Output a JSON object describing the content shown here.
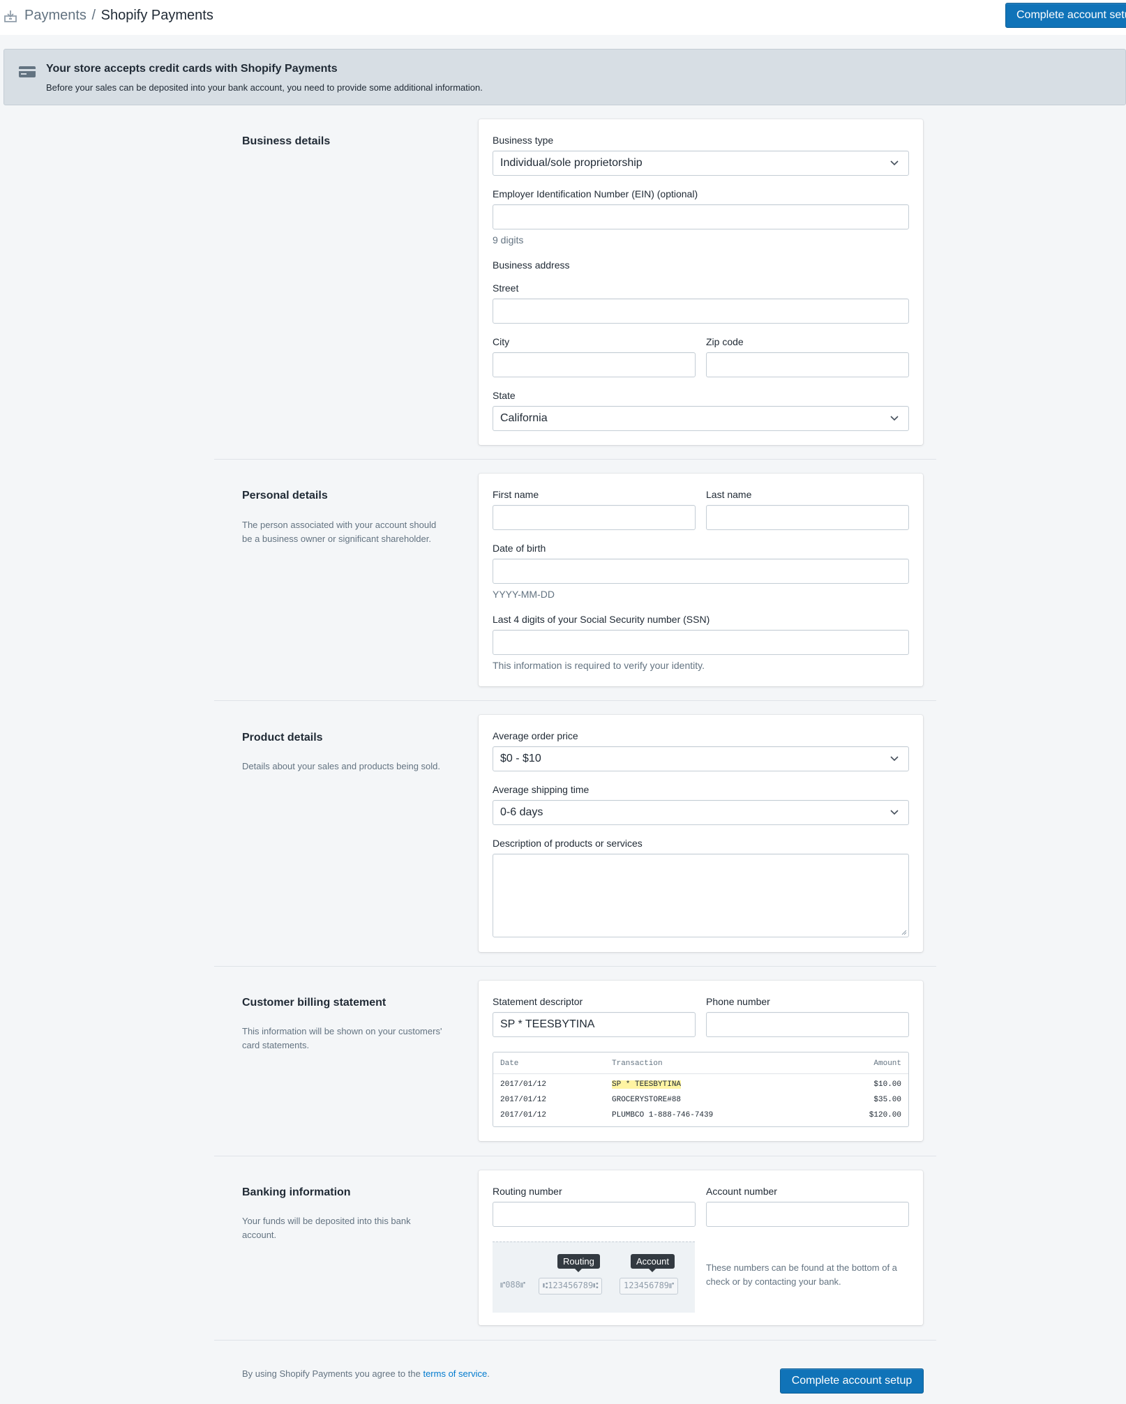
{
  "header": {
    "breadcrumb_parent": "Payments",
    "breadcrumb_separator": "/",
    "title": "Shopify Payments",
    "cta_label": "Complete account setup"
  },
  "banner": {
    "title": "Your store accepts credit cards with Shopify Payments",
    "text": "Before your sales can be deposited into your bank account, you need to provide some additional information."
  },
  "business": {
    "title": "Business details",
    "type_label": "Business type",
    "type_value": "Individual/sole proprietorship",
    "ein_label": "Employer Identification Number (EIN) (optional)",
    "ein_value": "",
    "ein_help": "9 digits",
    "address_label": "Business address",
    "street_label": "Street",
    "street_value": "",
    "city_label": "City",
    "city_value": "",
    "zip_label": "Zip code",
    "zip_value": "",
    "state_label": "State",
    "state_value": "California"
  },
  "personal": {
    "title": "Personal details",
    "description": "The person associated with your account should be a business owner or significant shareholder.",
    "first_name_label": "First name",
    "first_name_value": "",
    "last_name_label": "Last name",
    "last_name_value": "",
    "dob_label": "Date of birth",
    "dob_value": "",
    "dob_help": "YYYY-MM-DD",
    "ssn_label": "Last 4 digits of your Social Security number (SSN)",
    "ssn_value": "",
    "ssn_help": "This information is required to verify your identity."
  },
  "product": {
    "title": "Product details",
    "description": "Details about your sales and products being sold.",
    "avg_price_label": "Average order price",
    "avg_price_value": "$0 - $10",
    "avg_shipping_label": "Average shipping time",
    "avg_shipping_value": "0-6 days",
    "desc_label": "Description of products or services",
    "desc_value": ""
  },
  "billing": {
    "title": "Customer billing statement",
    "description": "This information will be shown on your customers' card statements.",
    "descriptor_label": "Statement descriptor",
    "descriptor_value": "SP * TEESBYTINA",
    "phone_label": "Phone number",
    "phone_value": "",
    "table": {
      "headers": [
        "Date",
        "Transaction",
        "Amount"
      ],
      "rows": [
        {
          "date": "2017/01/12",
          "transaction": "SP * TEESBYTINA",
          "amount": "$10.00"
        },
        {
          "date": "2017/01/12",
          "transaction": "GROCERYSTORE#88",
          "amount": "$35.00"
        },
        {
          "date": "2017/01/12",
          "transaction": "PLUMBCO 1-888-746-7439",
          "amount": "$120.00"
        }
      ]
    }
  },
  "banking": {
    "title": "Banking information",
    "description": "Your funds will be deposited into this bank account.",
    "routing_label": "Routing number",
    "routing_value": "",
    "account_label": "Account number",
    "account_value": "",
    "check_routing_tip": "Routing",
    "check_account_tip": "Account",
    "check_cheque_number": "⑈088⑈",
    "check_routing_digits": "⑆123456789⑆",
    "check_account_digits": "123456789⑈",
    "help": "These numbers can be found at the bottom of a check or by contacting your bank."
  },
  "footer": {
    "agree_prefix": "By using Shopify Payments you agree to the",
    "terms_link": "terms of service",
    "agree_suffix": ".",
    "cta_label": "Complete account setup"
  },
  "colors": {
    "primary": "#1073b8",
    "link": "#007ace",
    "banner_bg": "#d7dee4",
    "page_bg": "#f4f6f8",
    "highlight": "#fff4a3"
  },
  "icons": {
    "topbar": "payments-icon",
    "banner": "credit-card-icon",
    "select": "chevron-down-icon"
  }
}
